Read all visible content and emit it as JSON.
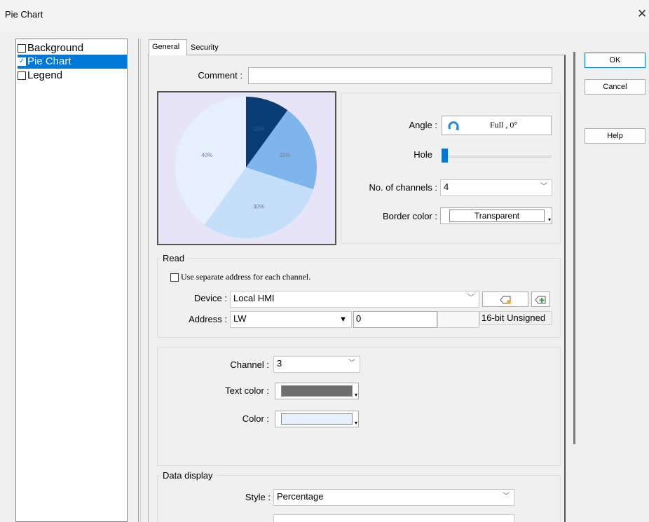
{
  "window": {
    "title": "Pie Chart",
    "close_glyph": "✕"
  },
  "tree": {
    "items": [
      {
        "label": "Background",
        "checked": false,
        "selected": false
      },
      {
        "label": "Pie Chart",
        "checked": true,
        "selected": true
      },
      {
        "label": "Legend",
        "checked": false,
        "selected": false
      }
    ]
  },
  "tabs": [
    {
      "label": "General",
      "active": true
    },
    {
      "label": "Security",
      "active": false
    }
  ],
  "comment": {
    "label": "Comment :",
    "value": ""
  },
  "chart_data": {
    "type": "pie",
    "categories": [
      "10%",
      "20%",
      "30%",
      "40%"
    ],
    "values": [
      10,
      20,
      30,
      40
    ],
    "colors": [
      "#083c74",
      "#7fb4ec",
      "#c5defa",
      "#e6f0fc"
    ],
    "title": ""
  },
  "preview_background": "#e6e4f6",
  "angle": {
    "label": "Angle :",
    "value": "Full , 0°"
  },
  "hole": {
    "label": "Hole",
    "value": 0
  },
  "channels": {
    "label": "No. of channels :",
    "value": "4"
  },
  "border_color": {
    "label": "Border color :",
    "value": "Transparent"
  },
  "read": {
    "title": "Read",
    "separate_label": "Use separate address for each channel.",
    "separate_checked": false,
    "device_label": "Device :",
    "device_value": "Local HMI",
    "address_label": "Address :",
    "address_type": "LW",
    "address_value": "0",
    "data_format": "16-bit Unsigned"
  },
  "channel": {
    "label": "Channel :",
    "value": "3",
    "text_color_label": "Text color :",
    "text_color": "#6e6e6e",
    "color_label": "Color :",
    "color": "#e6f0fc"
  },
  "data_display": {
    "title": "Data display",
    "style_label": "Style :",
    "style_value": "Percentage"
  },
  "buttons": {
    "ok": "OK",
    "cancel": "Cancel",
    "help": "Help"
  },
  "colors": {
    "accent": "#0078d7",
    "hole_slider": "#0078d7"
  }
}
